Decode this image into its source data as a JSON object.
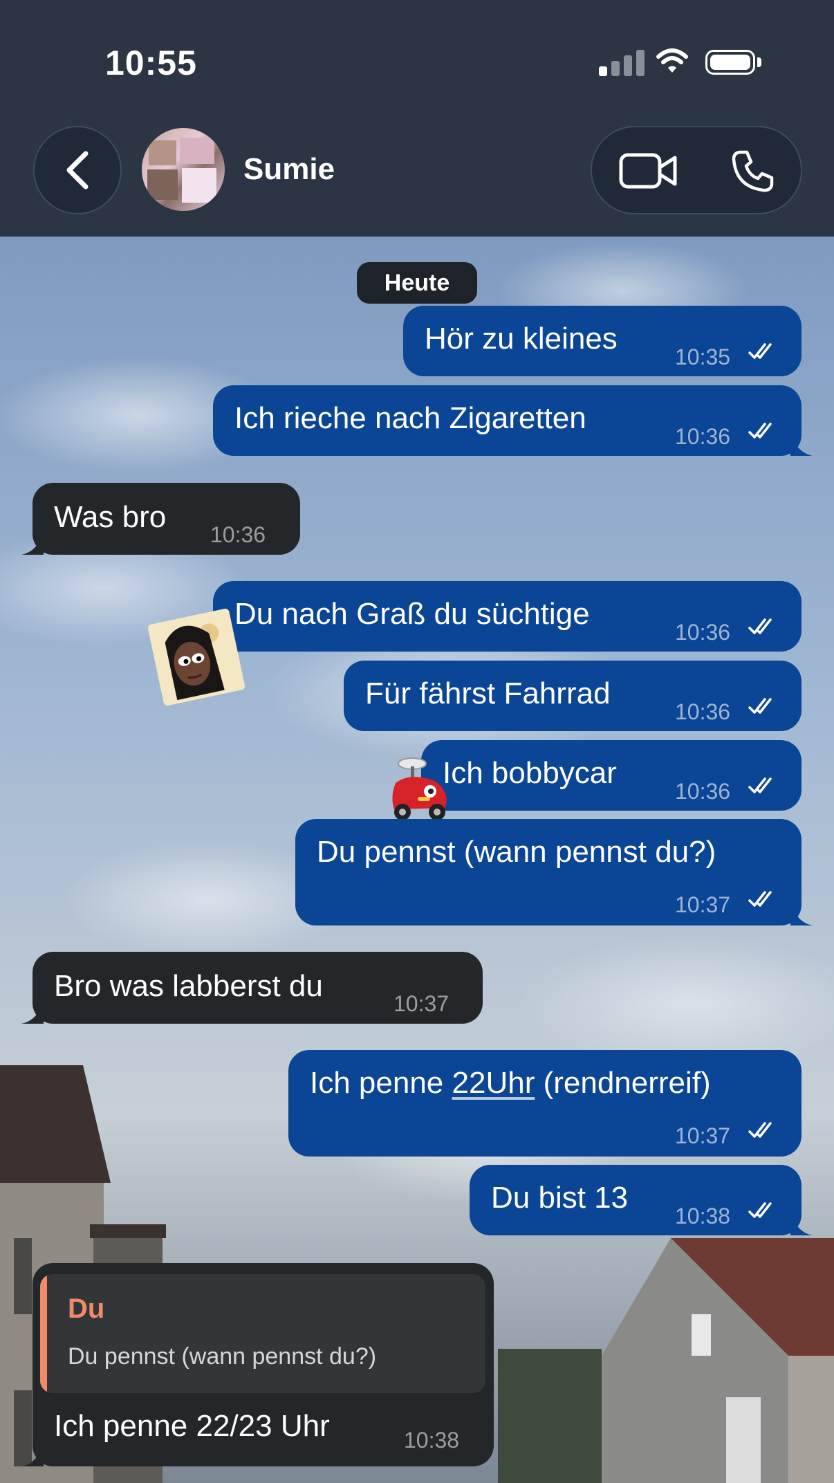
{
  "status_bar": {
    "time": "10:55"
  },
  "header": {
    "contact_name": "Sumie"
  },
  "chat": {
    "day_label": "Heute",
    "messages": [
      {
        "dir": "out",
        "text": "Hör zu kleines",
        "time": "10:35"
      },
      {
        "dir": "out",
        "text": "Ich rieche nach Zigaretten",
        "time": "10:36"
      },
      {
        "dir": "in",
        "text": "Was bro",
        "time": "10:36"
      },
      {
        "dir": "out",
        "text": "Du nach Graß du süchtige",
        "time": "10:36"
      },
      {
        "dir": "out",
        "text": "Für fährst Fahrrad",
        "time": "10:36"
      },
      {
        "dir": "out",
        "text": "Ich bobbycar",
        "time": "10:36"
      },
      {
        "dir": "out",
        "text": "Du pennst (wann pennst du?)",
        "time": "10:37"
      },
      {
        "dir": "in",
        "text": "Bro was labberst du",
        "time": "10:37"
      },
      {
        "dir": "out",
        "text_before": "Ich penne ",
        "text_link": "22Uhr",
        "text_after": " (rendnerreif)",
        "time": "10:37"
      },
      {
        "dir": "out",
        "text": "Du bist 13",
        "time": "10:38"
      },
      {
        "dir": "in",
        "reply_to": {
          "name": "Du",
          "text": "Du pennst (wann pennst du?)"
        },
        "text": "Ich penne 22/23 Uhr",
        "time": "10:38"
      }
    ]
  },
  "icons": {
    "back": "chevron-left-icon",
    "video": "video-camera-icon",
    "phone": "phone-icon",
    "read": "double-check-icon"
  },
  "colors": {
    "outgoing_bubble": "#0b4596",
    "incoming_bubble": "#242729",
    "reply_accent": "#f28a68",
    "header_bg": "#2b3543"
  }
}
